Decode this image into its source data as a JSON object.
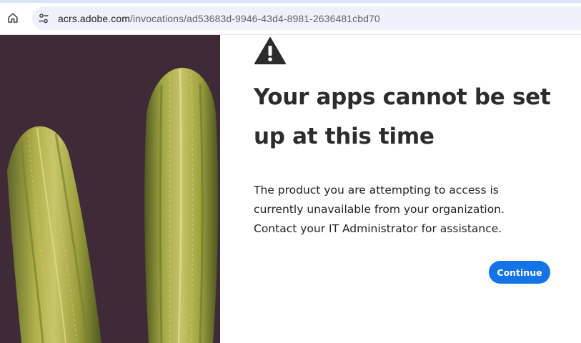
{
  "browser": {
    "url_host": "acrs.adobe.com",
    "url_path": "/invocations/ad53683d-9946-43d4-8981-2636481cbd70",
    "home_icon": "home-icon",
    "site_info_icon": "tune-icon"
  },
  "hero": {
    "image": "cactus-photo"
  },
  "error": {
    "icon": "warning-icon",
    "title": "Your apps cannot be set up at this time",
    "message": "The product you are attempting to access is currently unavailable from your organization. Contact your IT Administrator for assistance.",
    "continue_label": "Continue"
  },
  "colors": {
    "accent": "#1473e6",
    "hero_background": "#3f2b37",
    "omnibox": "#edf2fa"
  }
}
